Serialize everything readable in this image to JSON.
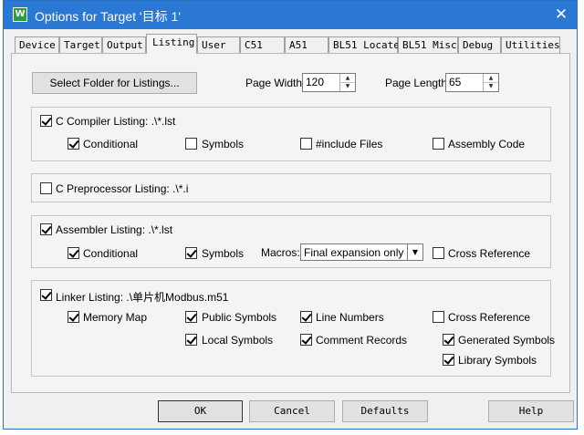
{
  "window": {
    "title": "Options for Target '目标 1'",
    "close_glyph": "✕",
    "app_icon_letter": "W",
    "accent_color": "#2b78d4"
  },
  "tabs": [
    {
      "label": "Device"
    },
    {
      "label": "Target"
    },
    {
      "label": "Output"
    },
    {
      "label": "Listing",
      "active": true
    },
    {
      "label": "User"
    },
    {
      "label": "C51"
    },
    {
      "label": "A51"
    },
    {
      "label": "BL51 Locate"
    },
    {
      "label": "BL51 Misc"
    },
    {
      "label": "Debug"
    },
    {
      "label": "Utilities"
    }
  ],
  "top": {
    "select_folder_label": "Select Folder for Listings...",
    "page_width_label": "Page Width:",
    "page_width_value": "120",
    "page_length_label": "Page Length:",
    "page_length_value": "65",
    "spin_up": "▲",
    "spin_down": "▼"
  },
  "c_compiler": {
    "label": "C Compiler Listing:  .\\*.lst",
    "checked": true,
    "conditional": "Conditional",
    "symbols": "Symbols",
    "include_files": "#include Files",
    "assembly_code": "Assembly Code"
  },
  "c_preprocessor": {
    "label": "C Preprocessor Listing:  .\\*.i",
    "checked": false
  },
  "assembler": {
    "label": "Assembler Listing:  .\\*.lst",
    "checked": true,
    "conditional": "Conditional",
    "symbols": "Symbols",
    "macros_label": "Macros:",
    "macros_value": "Final expansion only",
    "cross_reference": "Cross Reference",
    "dropdown_arrow": "▼"
  },
  "linker": {
    "label": "Linker Listing:  .\\单片机Modbus.m51",
    "checked": true,
    "memory_map": "Memory Map",
    "public_symbols": "Public Symbols",
    "line_numbers": "Line Numbers",
    "cross_reference": "Cross Reference",
    "local_symbols": "Local Symbols",
    "comment_records": "Comment Records",
    "generated_symbols": "Generated Symbols",
    "library_symbols": "Library Symbols"
  },
  "buttons": {
    "ok": "OK",
    "cancel": "Cancel",
    "defaults": "Defaults",
    "help": "Help"
  }
}
